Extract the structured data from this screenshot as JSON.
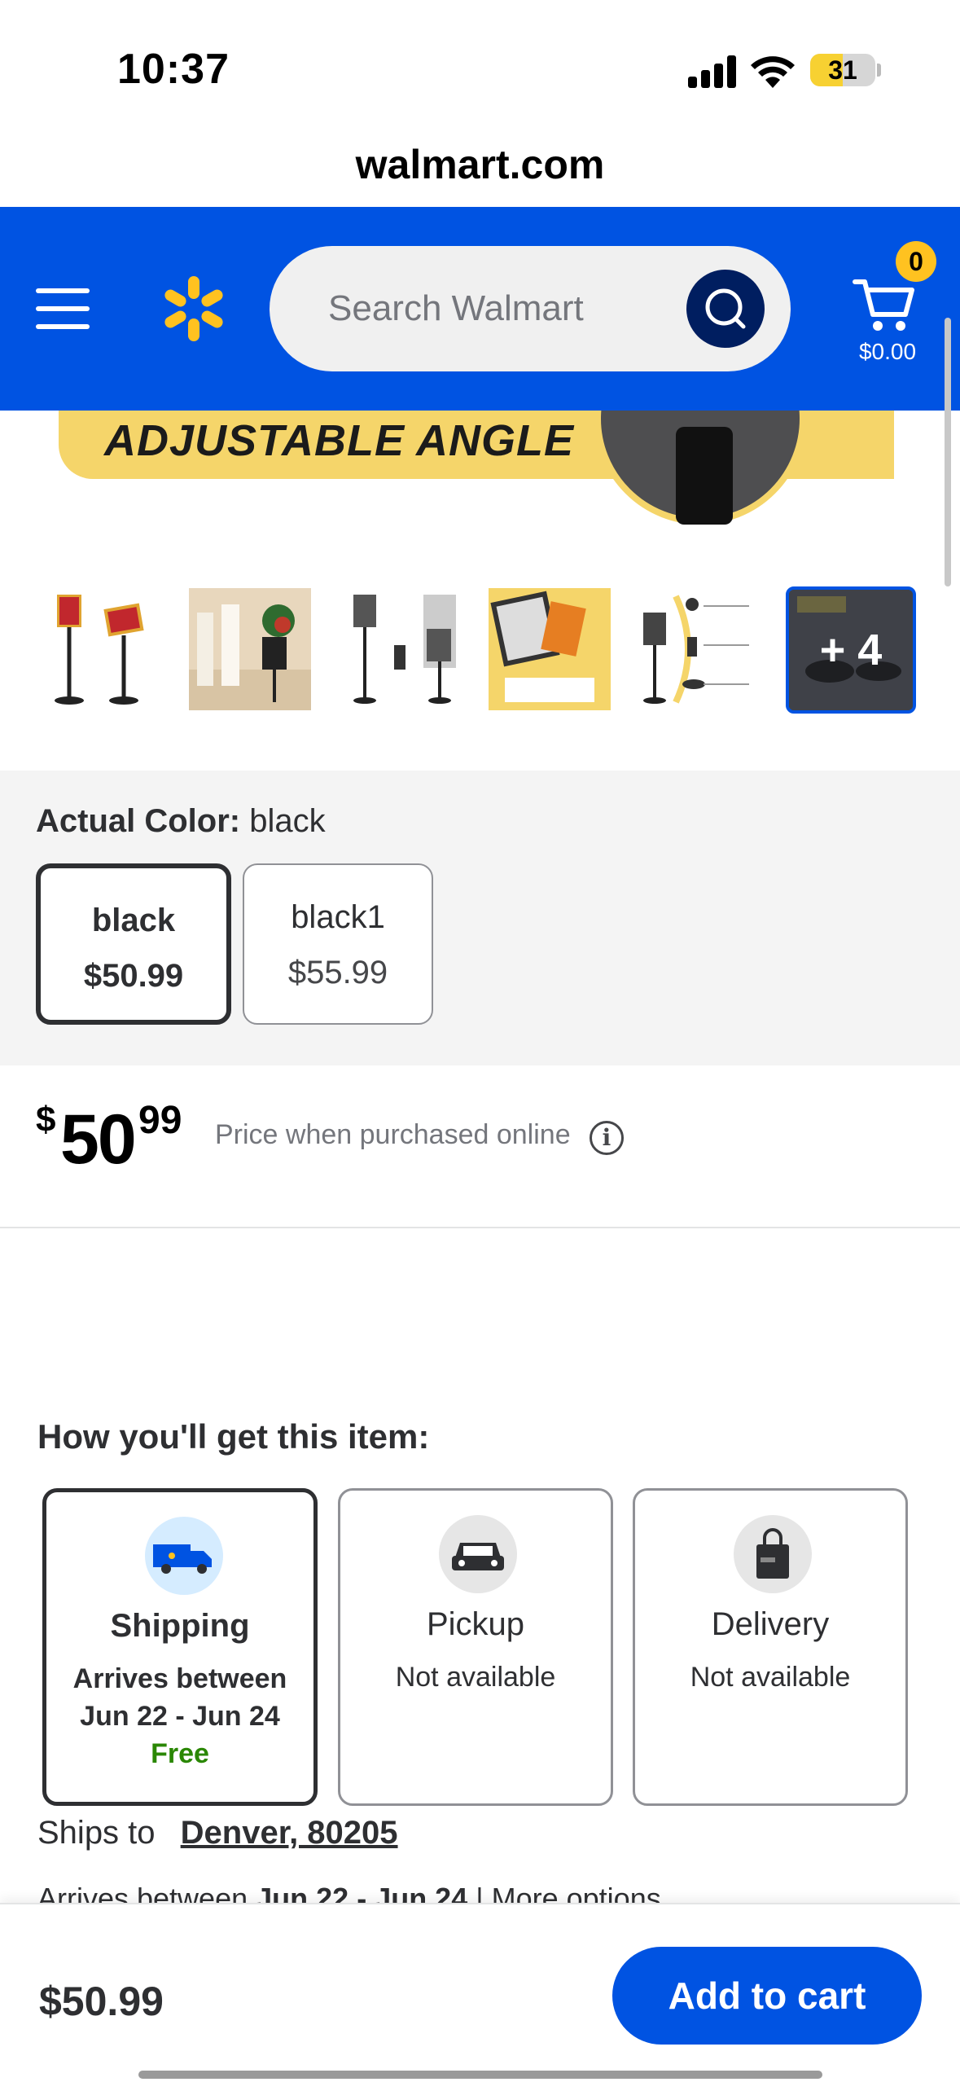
{
  "status_bar": {
    "time": "10:37",
    "battery": "31"
  },
  "browser": {
    "url": "walmart.com"
  },
  "header": {
    "search_placeholder": "Search Walmart",
    "cart_count": "0",
    "cart_total": "$0.00",
    "brand_color": "#0053e2",
    "spark_color": "#ffc220"
  },
  "hero": {
    "banner_text": "ADJUSTABLE ANGLE"
  },
  "gallery": {
    "more_count": "+ 4"
  },
  "variant": {
    "label": "Actual Color:",
    "selected_value": "black",
    "options": [
      {
        "name": "black",
        "price": "$50.99",
        "selected": true
      },
      {
        "name": "black1",
        "price": "$55.99",
        "selected": false
      }
    ]
  },
  "price": {
    "currency": "$",
    "dollars": "50",
    "cents": "99",
    "note": "Price when purchased online"
  },
  "fulfillment": {
    "title": "How you'll get this item:",
    "options": [
      {
        "name": "Shipping",
        "line1": "Arrives between",
        "line2": "Jun 22 - Jun 24",
        "line3": "Free",
        "selected": true
      },
      {
        "name": "Pickup",
        "line1": "Not available",
        "selected": false
      },
      {
        "name": "Delivery",
        "line1": "Not available",
        "selected": false
      }
    ],
    "ships_to_label": "Ships to",
    "ships_to_location": "Denver, 80205",
    "arrives_label": "Arrives between",
    "arrives_dates": "Jun 22 - Jun 24",
    "more_options": "More options"
  },
  "bottom_bar": {
    "price": "$50.99",
    "add_to_cart": "Add to cart"
  }
}
